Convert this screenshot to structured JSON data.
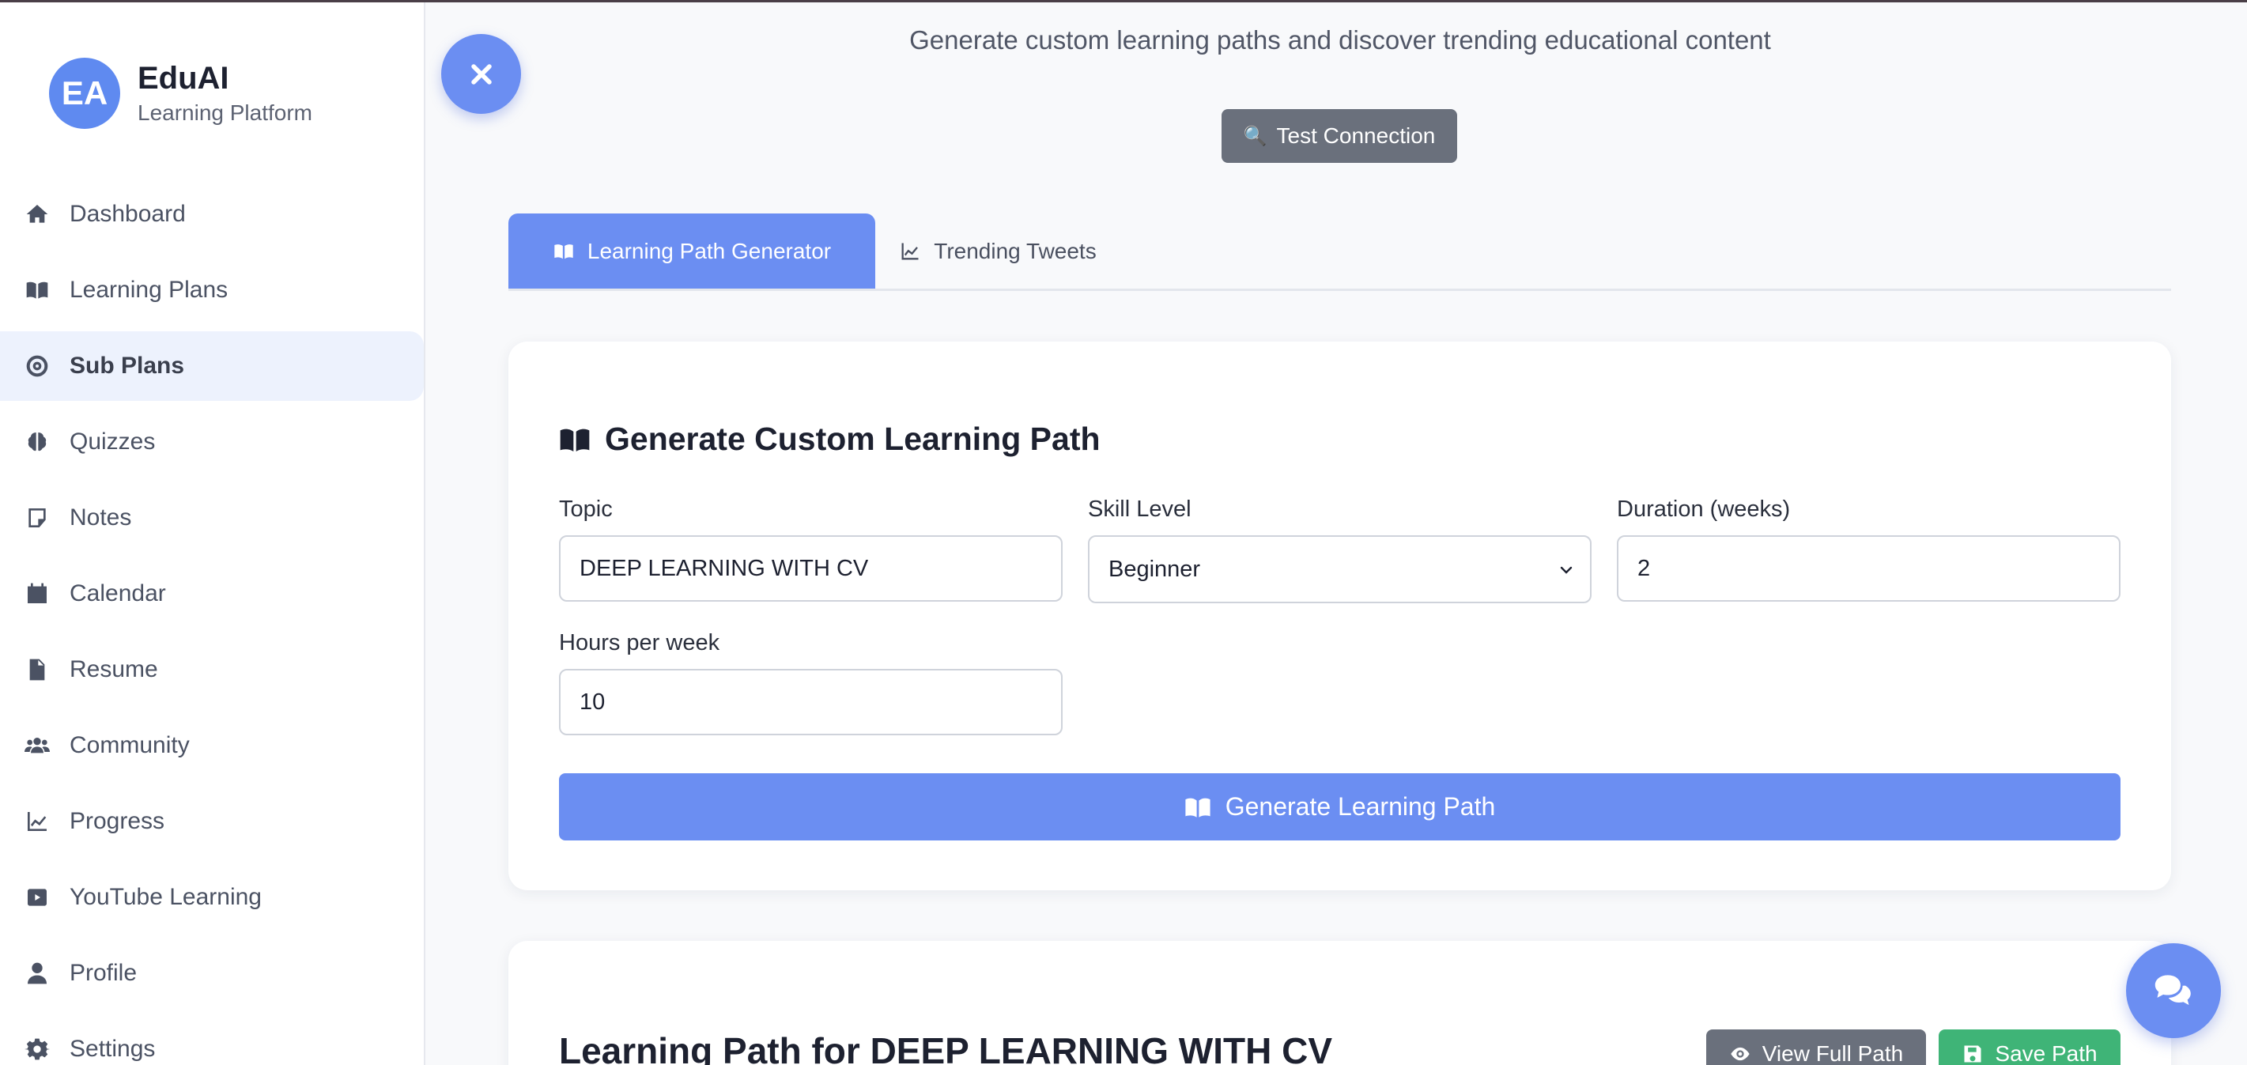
{
  "brand": {
    "initials": "EA",
    "name": "EduAI",
    "subtitle": "Learning Platform"
  },
  "sidebar": {
    "items": [
      {
        "label": "Dashboard",
        "icon": "home-icon",
        "active": false
      },
      {
        "label": "Learning Plans",
        "icon": "book-open-icon",
        "active": false
      },
      {
        "label": "Sub Plans",
        "icon": "target-icon",
        "active": true
      },
      {
        "label": "Quizzes",
        "icon": "brain-icon",
        "active": false
      },
      {
        "label": "Notes",
        "icon": "sticky-note-icon",
        "active": false
      },
      {
        "label": "Calendar",
        "icon": "calendar-icon",
        "active": false
      },
      {
        "label": "Resume",
        "icon": "file-icon",
        "active": false
      },
      {
        "label": "Community",
        "icon": "users-icon",
        "active": false
      },
      {
        "label": "Progress",
        "icon": "chart-line-icon",
        "active": false
      },
      {
        "label": "YouTube Learning",
        "icon": "youtube-icon",
        "active": false
      },
      {
        "label": "Profile",
        "icon": "user-icon",
        "active": false
      },
      {
        "label": "Settings",
        "icon": "gear-icon",
        "active": false
      }
    ]
  },
  "header": {
    "subtitle": "Generate custom learning paths and discover trending educational content",
    "test_connection_label": "Test Connection"
  },
  "tabs": [
    {
      "label": "Learning Path Generator",
      "active": true
    },
    {
      "label": "Trending Tweets",
      "active": false
    }
  ],
  "form": {
    "title": "Generate Custom Learning Path",
    "topic_label": "Topic",
    "topic_value": "DEEP LEARNING WITH CV",
    "skill_label": "Skill Level",
    "skill_value": "Beginner",
    "duration_label": "Duration (weeks)",
    "duration_value": "2",
    "hours_label": "Hours per week",
    "hours_value": "10",
    "generate_label": "Generate Learning Path"
  },
  "result": {
    "title": "Learning Path for DEEP LEARNING WITH CV",
    "view_label": "View Full Path",
    "save_label": "Save Path"
  },
  "colors": {
    "accent": "#6b8ef2",
    "gray_button": "#6a707c",
    "green_button": "#3fb477",
    "active_nav_bg": "#edf2fd"
  }
}
